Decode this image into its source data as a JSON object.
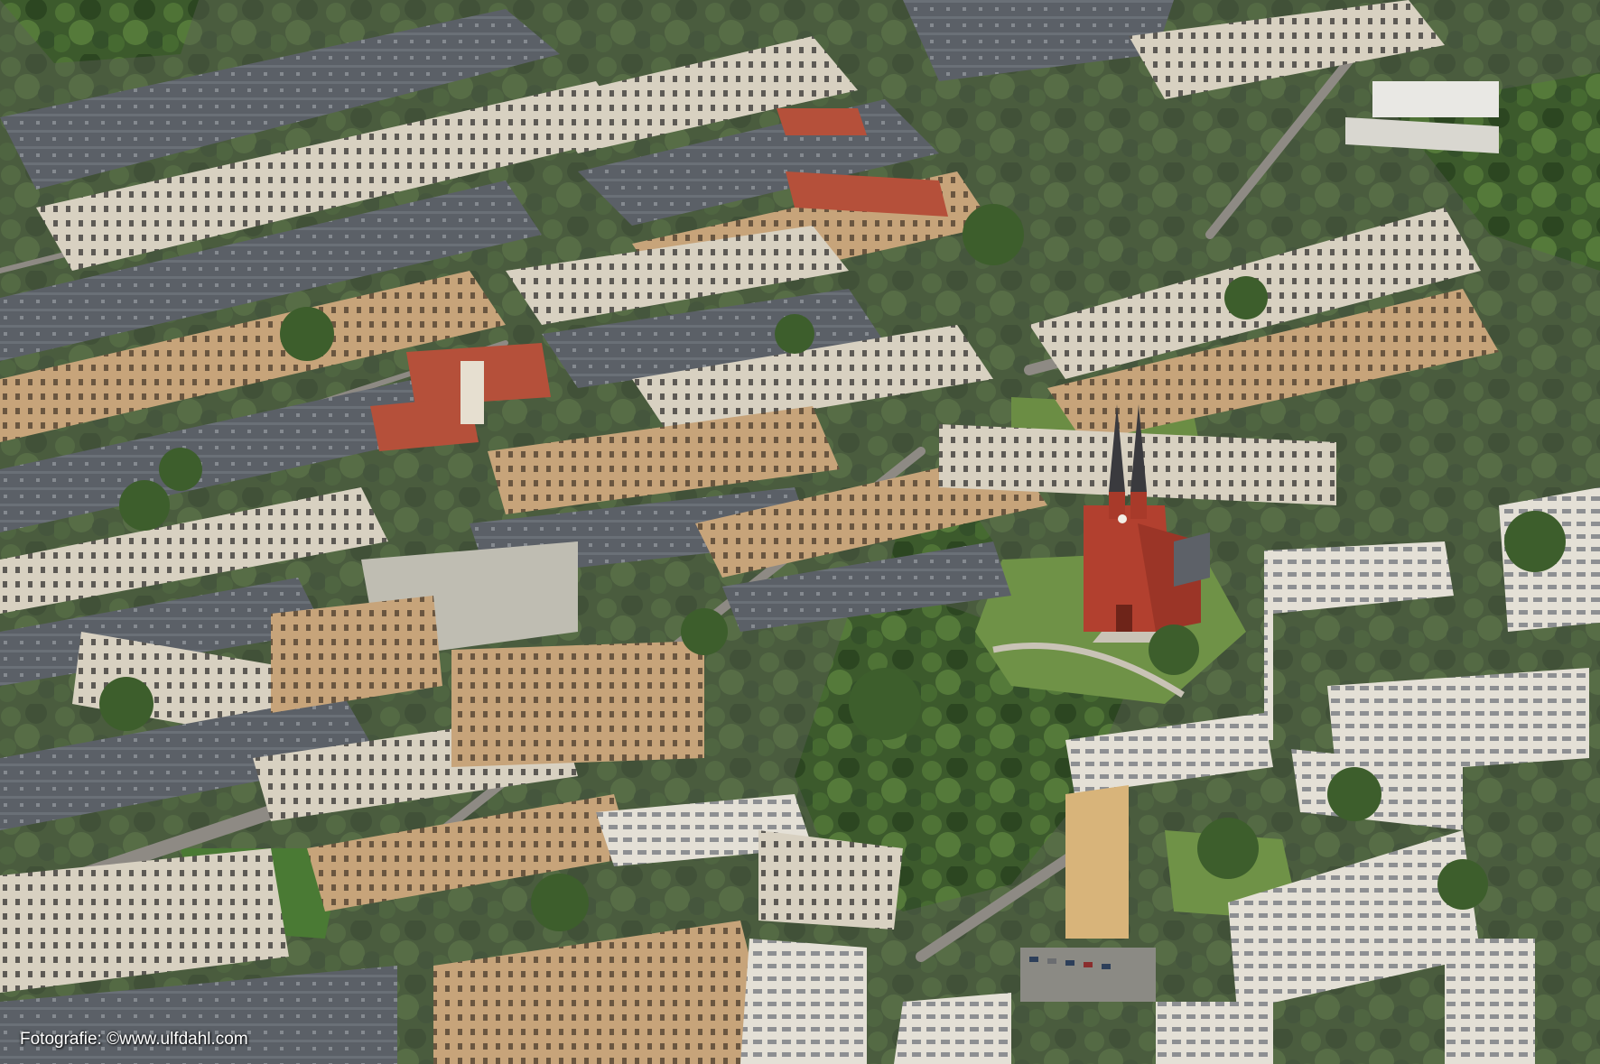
{
  "photo": {
    "credit": "Fotografie: ©www.ulfdahl.com",
    "palette": {
      "trees_dark": "#2f4a24",
      "trees_mid": "#4a6b34",
      "lawn": "#6f9247",
      "roof_grey": "#5d6168",
      "roof_red": "#b5503a",
      "facade_light": "#d9d3c4",
      "facade_ochre": "#c9a77e",
      "church_brick": "#b2402f",
      "street": "#8e8a84"
    }
  }
}
